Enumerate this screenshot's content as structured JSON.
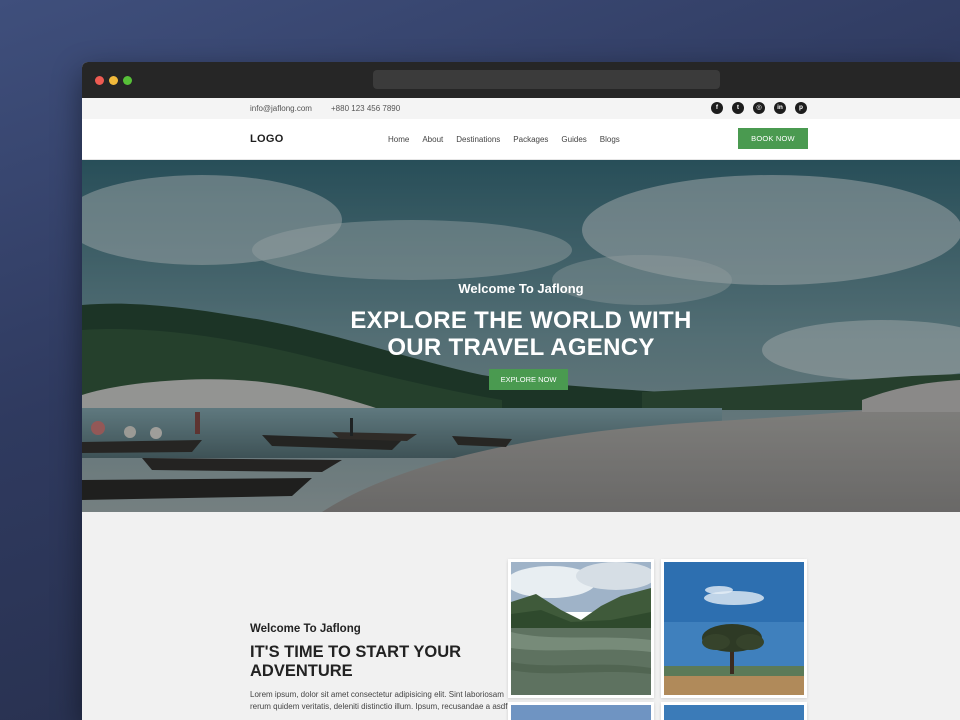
{
  "topbar": {
    "email": "info@jaflong.com",
    "phone": "+880 123 456 7890",
    "socials": [
      {
        "name": "facebook-icon",
        "glyph": "f"
      },
      {
        "name": "twitter-icon",
        "glyph": "t"
      },
      {
        "name": "instagram-icon",
        "glyph": "◎"
      },
      {
        "name": "linkedin-icon",
        "glyph": "in"
      },
      {
        "name": "pinterest-icon",
        "glyph": "p"
      }
    ]
  },
  "navbar": {
    "logo": "LOGO",
    "menu": [
      "Home",
      "About",
      "Destinations",
      "Packages",
      "Guides",
      "Blogs"
    ],
    "book_label": "BOOK NOW"
  },
  "hero": {
    "welcome": "Welcome To Jaflong",
    "title_line1": "EXPLORE THE WORLD WITH",
    "title_line2": "OUR TRAVEL AGENCY",
    "button_label": "EXPLORE NOW"
  },
  "about": {
    "subtitle": "Welcome To Jaflong",
    "heading_line1": "IT'S TIME TO START YOUR",
    "heading_line2": "ADVENTURE",
    "body": "Lorem ipsum, dolor sit amet consectetur adipisicing elit. Sint laboriosam rerum quidem veritatis, deleniti distinctio illum. Ipsum, recusandae a asdf"
  },
  "colors": {
    "accent_green": "#4a9a50",
    "titlebar": "#262626",
    "page_background": "#f1f1f1"
  }
}
